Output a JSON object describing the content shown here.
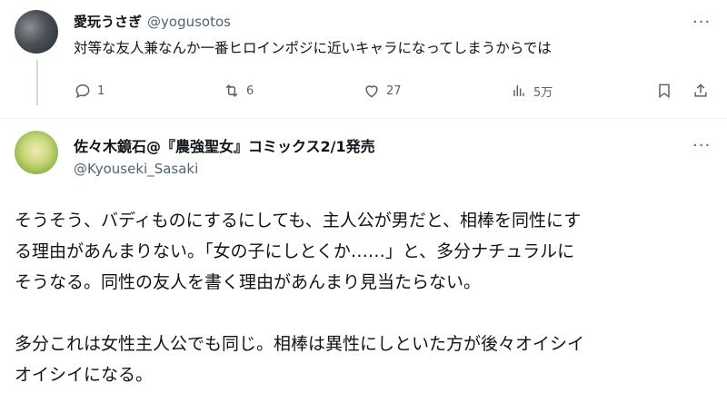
{
  "reply": {
    "display_name": "愛玩うさぎ",
    "handle": "@yogusotos",
    "text": "対等な友人兼なんか一番ヒロインポジに近いキャラになってしまうからでは",
    "actions": {
      "replies": "1",
      "reposts": "6",
      "likes": "27",
      "views": "5万"
    }
  },
  "post": {
    "display_name": "佐々木鏡石@『農強聖女』コミックス2/1発売",
    "handle": "@Kyouseki_Sasaki",
    "lines": [
      "そうそう、バディものにするにしても、主人公が男だと、相棒を同性にす",
      "る理由があんまりない。「女の子にしとくか……」と、多分ナチュラルに",
      "そうなる。同性の友人を書く理由があんまり見当たらない。",
      "",
      "多分これは女性主人公でも同じ。相棒は異性にしといた方が後々オイシイ",
      "オイシイになる。"
    ]
  },
  "more_label": "···"
}
